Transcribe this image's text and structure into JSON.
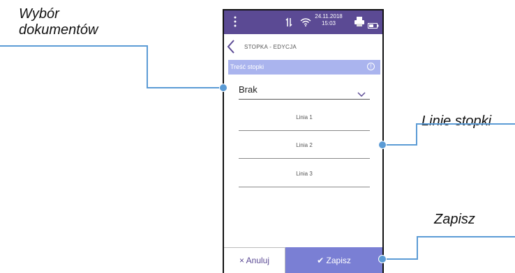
{
  "callouts": {
    "documents_line1": "Wybór",
    "documents_line2": "dokumentów",
    "footer_lines": "Linie stopki",
    "save": "Zapisz"
  },
  "statusbar": {
    "date": "24.11.2018",
    "time": "15:03"
  },
  "header": {
    "title": "STOPKA - EDYCJA"
  },
  "section": {
    "title": "Treść stopki"
  },
  "select": {
    "value": "Brak"
  },
  "lines": [
    "Linia 1",
    "Linia 2",
    "Linia 3"
  ],
  "footer": {
    "cancel_icon": "×",
    "cancel_label": "Anuluj",
    "save_icon": "✔",
    "save_label": "Zapisz"
  },
  "colors": {
    "statusbar": "#5b4a94",
    "section_bar": "#aab4ee",
    "save_button": "#7a7fd4",
    "callout_line": "#5b9bd5"
  }
}
